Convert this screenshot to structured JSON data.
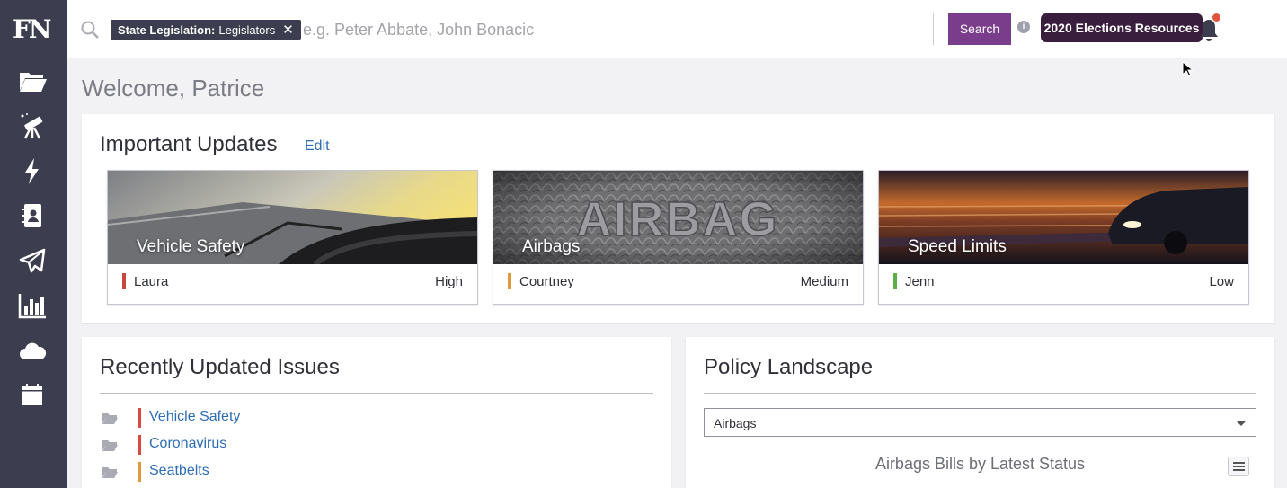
{
  "app": {
    "logo": "FN"
  },
  "sidebar": {
    "items": [
      {
        "name": "folder-icon"
      },
      {
        "name": "telescope-icon"
      },
      {
        "name": "lightning-icon"
      },
      {
        "name": "contacts-icon"
      },
      {
        "name": "paper-plane-icon"
      },
      {
        "name": "bar-chart-icon"
      },
      {
        "name": "cloud-icon"
      },
      {
        "name": "calendar-icon"
      }
    ]
  },
  "search": {
    "chip_category": "State Legislation:",
    "chip_value": "Legislators",
    "chip_close": "✕",
    "placeholder": "e.g. Peter Abbate, John Bonacic",
    "button_label": "Search",
    "info": "i"
  },
  "header": {
    "elections_button": "2020 Elections Resources",
    "welcome": "Welcome, Patrice"
  },
  "updates": {
    "title": "Important Updates",
    "edit_label": "Edit",
    "cards": [
      {
        "title": "Vehicle Safety",
        "owner": "Laura",
        "priority": "High",
        "priority_color": "#c9463d"
      },
      {
        "title": "Airbags",
        "owner": "Courtney",
        "priority": "Medium",
        "priority_color": "#e09a3e"
      },
      {
        "title": "Speed Limits",
        "owner": "Jenn",
        "priority": "Low",
        "priority_color": "#5cad46"
      }
    ]
  },
  "issues": {
    "title": "Recently Updated Issues",
    "items": [
      {
        "label": "Vehicle Safety",
        "color": "#d94a43"
      },
      {
        "label": "Coronavirus",
        "color": "#d94a43"
      },
      {
        "label": "Seatbelts",
        "color": "#e09a3e"
      }
    ]
  },
  "policy": {
    "title": "Policy Landscape",
    "selected": "Airbags",
    "chart_title": "Airbags Bills by Latest Status"
  },
  "colors": {
    "sidebar_bg": "#3c3e4f",
    "accent": "#7a3d8c",
    "link": "#2d6db5",
    "elections_bg": "#3a1e3d"
  }
}
